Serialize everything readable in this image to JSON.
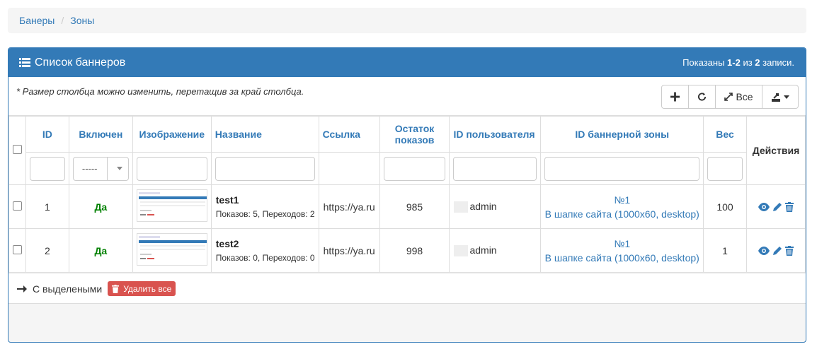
{
  "breadcrumb": {
    "items": [
      "Банеры",
      "Зоны"
    ],
    "separator": "/"
  },
  "panel": {
    "title": "Список баннеров",
    "summary_prefix": "Показаны ",
    "summary_range": "1-2",
    "summary_mid": " из ",
    "summary_total": "2",
    "summary_suffix": " записи."
  },
  "note": "* Размер столбца можно изменить, перетащив за край столбца.",
  "toolbar": {
    "all_label": "Все",
    "icons": [
      "plus-icon",
      "refresh-icon",
      "expand-icon",
      "export-icon"
    ]
  },
  "columns": {
    "id": "ID",
    "enabled": "Включен",
    "image": "Изображение",
    "name": "Название",
    "link": "Ссылка",
    "remaining": "Остаток показов",
    "user_id": "ID пользователя",
    "zone_id": "ID баннерной зоны",
    "weight": "Вес",
    "actions": "Действия"
  },
  "filters": {
    "enabled_select": "-----"
  },
  "rows": [
    {
      "id": "1",
      "enabled": "Да",
      "name": "test1",
      "stats": "Показов: 5, Переходов: 2",
      "link": "https://ya.ru",
      "remaining": "985",
      "user": "admin",
      "zone_num": "№1",
      "zone_name": "В шапке сайта (1000x60, desktop)",
      "weight": "100"
    },
    {
      "id": "2",
      "enabled": "Да",
      "name": "test2",
      "stats": "Показов: 0, Переходов: 0",
      "link": "https://ya.ru",
      "remaining": "998",
      "user": "admin",
      "zone_num": "№1",
      "zone_name": "В шапке сайта (1000x60, desktop)",
      "weight": "1"
    }
  ],
  "footer": {
    "with_selected": "С выделеными",
    "delete_all": "Удалить все"
  },
  "colors": {
    "primary": "#337ab7",
    "success": "#008000",
    "danger": "#d9534f"
  }
}
